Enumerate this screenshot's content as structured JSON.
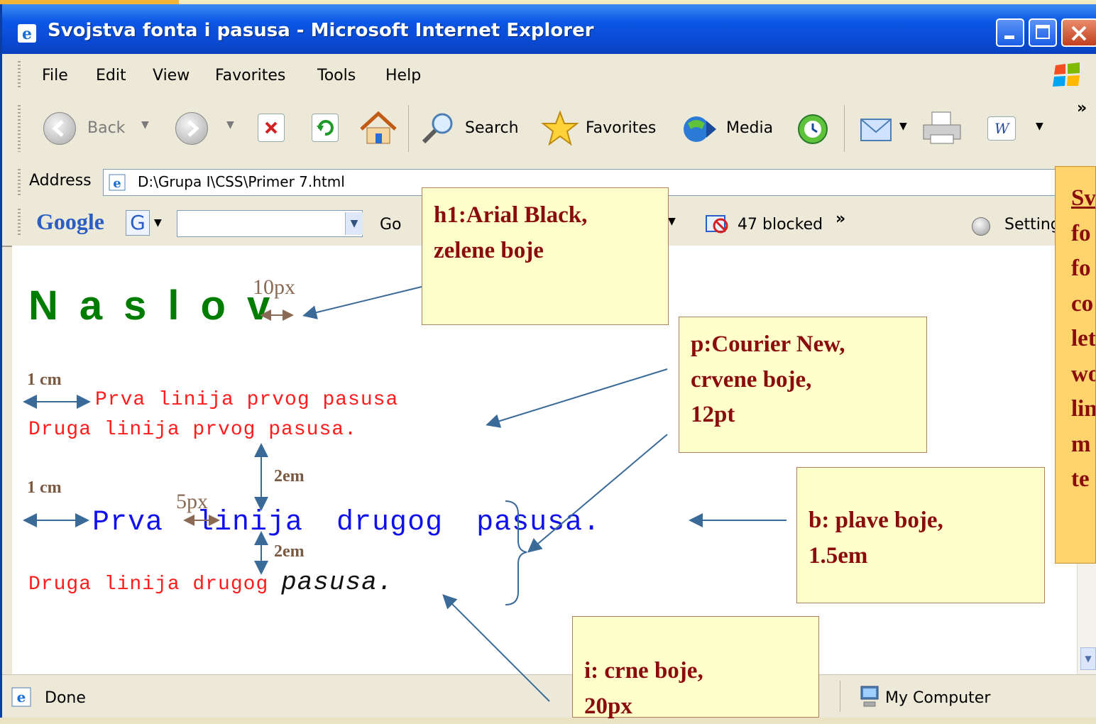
{
  "window": {
    "title": "Svojstva fonta i pasusa - Microsoft Internet Explorer"
  },
  "menu": [
    "File",
    "Edit",
    "View",
    "Favorites",
    "Tools",
    "Help"
  ],
  "toolbar": {
    "back": "Back",
    "search": "Search",
    "favorites": "Favorites",
    "media": "Media",
    "more": "»"
  },
  "address": {
    "label": "Address",
    "value": "D:\\Grupa I\\CSS\\Primer 7.html"
  },
  "google_bar": {
    "logo": "Google",
    "go": "Go",
    "blocked": "47 blocked",
    "settings": "Settings",
    "more": "»"
  },
  "page": {
    "heading": "Naslov",
    "p1_line1": "Prva linija prvog pasusa",
    "p1_line2": "Druga linija prvog pasusa.",
    "p2_line1": "Prva linija drugog pasusa.",
    "p2_line2_plain": "Druga linija drugog ",
    "p2_line2_italic": "pasusa."
  },
  "annotations": {
    "h1_spacing": "10px",
    "indent1": "1 cm",
    "indent2": "1 cm",
    "gap_above": "2em",
    "gap_below": "2em",
    "word_spacing": "5px"
  },
  "callouts": {
    "h1": [
      "h1:Arial Black,",
      "zelene boje"
    ],
    "p": [
      "p:Courier New,",
      "crvene boje,",
      "12pt"
    ],
    "b": [
      "b: plave boje,",
      "1.5em"
    ],
    "i": [
      "i: crne boje,",
      "20px"
    ],
    "side": {
      "underlined": "Sv",
      "lines": [
        "fo",
        "fo",
        "co",
        "let",
        "wo",
        "lin",
        "m",
        "te"
      ]
    }
  },
  "status": {
    "left": "Done",
    "zone": "My Computer"
  },
  "colors": {
    "heading": "#007d00",
    "paragraph": "#ff1c1c",
    "bold": "#1010ee",
    "italic": "#111111",
    "callout_text": "#8a0c0c",
    "callout_bg": "#ffffcc",
    "side_bg": "#fdd36c",
    "arrow": "#3a6a98"
  }
}
